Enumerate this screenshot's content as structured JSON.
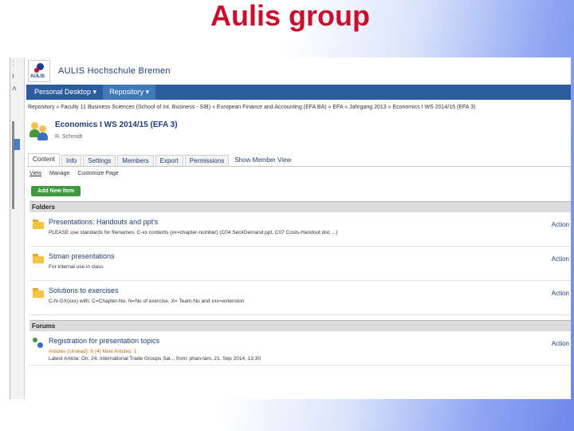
{
  "slide": {
    "title": "Aulis group"
  },
  "app": {
    "logo_text": "AULIS",
    "name": "AULIS Hochschule Bremen",
    "menu": [
      {
        "label": "Personal Desktop ▾"
      },
      {
        "label": "Repository ▾"
      }
    ],
    "breadcrumb": "Repository » Faculty 11 Business Sciences (School of Int. Business - SIB) » European Finance and Accounting (EFA BA) » EFA » Jahrgang 2013 » Economics I WS 2014/15 (EFA 3)",
    "group": {
      "title": "Economics I WS 2014/15 (EFA 3)",
      "description": "R. Schmidt"
    },
    "tabs": [
      {
        "label": "Content"
      },
      {
        "label": "Info"
      },
      {
        "label": "Settings"
      },
      {
        "label": "Members"
      },
      {
        "label": "Export"
      },
      {
        "label": "Permissions"
      },
      {
        "label": "Show Member View"
      }
    ],
    "subtabs": [
      {
        "label": "View"
      },
      {
        "label": "Manage"
      },
      {
        "label": "Customize Page"
      }
    ],
    "add_button": "Add New Item",
    "folders": {
      "heading": "Folders",
      "items": [
        {
          "title": "Presentations: Handouts and ppt's",
          "description": "PLEASE use standards for filenames: C-xx contents (xx=chapter-number) (C04 SeckDemand.ppt, C07 Costs-Handout.doc ...)",
          "actions": "Action"
        },
        {
          "title": "Stman presentations",
          "description": "For internal use in class",
          "actions": "Action"
        },
        {
          "title": "Solutions to exercises",
          "description": "C-N-GX(xxx) with: C=Chapter-No, N=No of exercise, X= Team-No and xxx=extension",
          "actions": "Action"
        }
      ]
    },
    "forums": {
      "heading": "Forums",
      "items": [
        {
          "title": "Registration for presentation topics",
          "stats": "Articles (Unread): 6 (4)   New Articles: 1",
          "latest": "Latest Article: On: 24: International Trade Groups Sat... from: phan-lam, 21. Sep 2014, 13:30",
          "actions": "Action"
        }
      ]
    }
  }
}
